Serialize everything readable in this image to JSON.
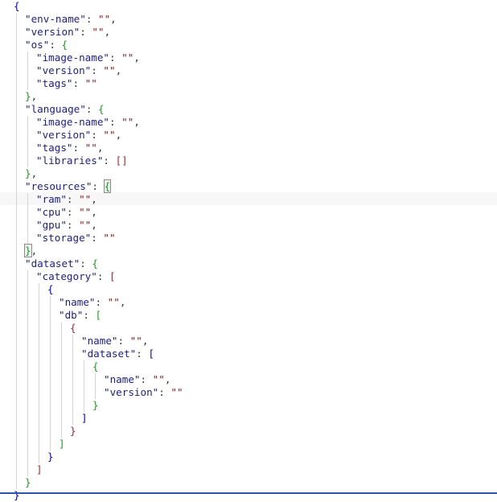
{
  "colors": {
    "key": "#1a1aa6",
    "string": "#a31515",
    "punct": "#333333",
    "bracket_levels": [
      "#0000c8",
      "#16a516",
      "#9b2c2c"
    ]
  },
  "editor": {
    "lines": [
      {
        "indent": 0,
        "tokens": [
          {
            "t": "{",
            "k": "b",
            "lv": 0
          }
        ]
      },
      {
        "indent": 1,
        "tokens": [
          {
            "t": "\"env-name\"",
            "k": "key"
          },
          {
            "t": ": ",
            "k": "p"
          },
          {
            "t": "\"\"",
            "k": "str"
          },
          {
            "t": ",",
            "k": "p"
          }
        ]
      },
      {
        "indent": 1,
        "tokens": [
          {
            "t": "\"version\"",
            "k": "key"
          },
          {
            "t": ": ",
            "k": "p"
          },
          {
            "t": "\"\"",
            "k": "str"
          },
          {
            "t": ",",
            "k": "p"
          }
        ]
      },
      {
        "indent": 1,
        "tokens": [
          {
            "t": "\"os\"",
            "k": "key"
          },
          {
            "t": ": ",
            "k": "p"
          },
          {
            "t": "{",
            "k": "b",
            "lv": 1
          }
        ]
      },
      {
        "indent": 2,
        "tokens": [
          {
            "t": "\"image-name\"",
            "k": "key"
          },
          {
            "t": ": ",
            "k": "p"
          },
          {
            "t": "\"\"",
            "k": "str"
          },
          {
            "t": ",",
            "k": "p"
          }
        ]
      },
      {
        "indent": 2,
        "tokens": [
          {
            "t": "\"version\"",
            "k": "key"
          },
          {
            "t": ": ",
            "k": "p"
          },
          {
            "t": "\"\"",
            "k": "str"
          },
          {
            "t": ",",
            "k": "p"
          }
        ]
      },
      {
        "indent": 2,
        "tokens": [
          {
            "t": "\"tags\"",
            "k": "key"
          },
          {
            "t": ": ",
            "k": "p"
          },
          {
            "t": "\"\"",
            "k": "str"
          }
        ]
      },
      {
        "indent": 1,
        "tokens": [
          {
            "t": "}",
            "k": "b",
            "lv": 1
          },
          {
            "t": ",",
            "k": "p"
          }
        ]
      },
      {
        "indent": 1,
        "tokens": [
          {
            "t": "\"language\"",
            "k": "key"
          },
          {
            "t": ": ",
            "k": "p"
          },
          {
            "t": "{",
            "k": "b",
            "lv": 1
          }
        ]
      },
      {
        "indent": 2,
        "tokens": [
          {
            "t": "\"image-name\"",
            "k": "key"
          },
          {
            "t": ": ",
            "k": "p"
          },
          {
            "t": "\"\"",
            "k": "str"
          },
          {
            "t": ",",
            "k": "p"
          }
        ]
      },
      {
        "indent": 2,
        "tokens": [
          {
            "t": "\"version\"",
            "k": "key"
          },
          {
            "t": ": ",
            "k": "p"
          },
          {
            "t": "\"\"",
            "k": "str"
          },
          {
            "t": ",",
            "k": "p"
          }
        ]
      },
      {
        "indent": 2,
        "tokens": [
          {
            "t": "\"tags\"",
            "k": "key"
          },
          {
            "t": ": ",
            "k": "p"
          },
          {
            "t": "\"\"",
            "k": "str"
          },
          {
            "t": ",",
            "k": "p"
          }
        ]
      },
      {
        "indent": 2,
        "tokens": [
          {
            "t": "\"libraries\"",
            "k": "key"
          },
          {
            "t": ": ",
            "k": "p"
          },
          {
            "t": "[]",
            "k": "b",
            "lv": 2
          }
        ]
      },
      {
        "indent": 1,
        "tokens": [
          {
            "t": "}",
            "k": "b",
            "lv": 1
          },
          {
            "t": ",",
            "k": "p"
          }
        ]
      },
      {
        "indent": 1,
        "tokens": [
          {
            "t": "\"resources\"",
            "k": "key"
          },
          {
            "t": ": ",
            "k": "p"
          },
          {
            "t": "{",
            "k": "b",
            "lv": 1,
            "hl": true
          }
        ]
      },
      {
        "indent": 2,
        "tokens": [
          {
            "t": "\"ram\"",
            "k": "key"
          },
          {
            "t": ": ",
            "k": "p"
          },
          {
            "t": "\"\"",
            "k": "str"
          },
          {
            "t": ",",
            "k": "p"
          }
        ]
      },
      {
        "indent": 2,
        "tokens": [
          {
            "t": "\"cpu\"",
            "k": "key"
          },
          {
            "t": ": ",
            "k": "p"
          },
          {
            "t": "\"\"",
            "k": "str"
          },
          {
            "t": ",",
            "k": "p"
          }
        ]
      },
      {
        "indent": 2,
        "tokens": [
          {
            "t": "\"gpu\"",
            "k": "key"
          },
          {
            "t": ": ",
            "k": "p"
          },
          {
            "t": "\"\"",
            "k": "str"
          },
          {
            "t": ",",
            "k": "p"
          }
        ]
      },
      {
        "indent": 2,
        "tokens": [
          {
            "t": "\"storage\"",
            "k": "key"
          },
          {
            "t": ": ",
            "k": "p"
          },
          {
            "t": "\"\"",
            "k": "str"
          }
        ]
      },
      {
        "indent": 1,
        "tokens": [
          {
            "t": "}",
            "k": "b",
            "lv": 1,
            "hl": true
          },
          {
            "t": ",",
            "k": "p"
          }
        ]
      },
      {
        "indent": 1,
        "tokens": [
          {
            "t": "\"dataset\"",
            "k": "key"
          },
          {
            "t": ": ",
            "k": "p"
          },
          {
            "t": "{",
            "k": "b",
            "lv": 1
          }
        ]
      },
      {
        "indent": 2,
        "tokens": [
          {
            "t": "\"category\"",
            "k": "key"
          },
          {
            "t": ": ",
            "k": "p"
          },
          {
            "t": "[",
            "k": "b",
            "lv": 2
          }
        ]
      },
      {
        "indent": 3,
        "tokens": [
          {
            "t": "{",
            "k": "b",
            "lv": 0
          }
        ]
      },
      {
        "indent": 4,
        "tokens": [
          {
            "t": "\"name\"",
            "k": "key"
          },
          {
            "t": ": ",
            "k": "p"
          },
          {
            "t": "\"\"",
            "k": "str"
          },
          {
            "t": ",",
            "k": "p"
          }
        ]
      },
      {
        "indent": 4,
        "tokens": [
          {
            "t": "\"db\"",
            "k": "key"
          },
          {
            "t": ": ",
            "k": "p"
          },
          {
            "t": "[",
            "k": "b",
            "lv": 1
          }
        ]
      },
      {
        "indent": 5,
        "tokens": [
          {
            "t": "{",
            "k": "b",
            "lv": 2
          }
        ]
      },
      {
        "indent": 6,
        "tokens": [
          {
            "t": "\"name\"",
            "k": "key"
          },
          {
            "t": ": ",
            "k": "p"
          },
          {
            "t": "\"\"",
            "k": "str"
          },
          {
            "t": ",",
            "k": "p"
          }
        ]
      },
      {
        "indent": 6,
        "tokens": [
          {
            "t": "\"dataset\"",
            "k": "key"
          },
          {
            "t": ": ",
            "k": "p"
          },
          {
            "t": "[",
            "k": "b",
            "lv": 0
          }
        ]
      },
      {
        "indent": 7,
        "tokens": [
          {
            "t": "{",
            "k": "b",
            "lv": 1
          }
        ]
      },
      {
        "indent": 8,
        "tokens": [
          {
            "t": "\"name\"",
            "k": "key"
          },
          {
            "t": ": ",
            "k": "p"
          },
          {
            "t": "\"\"",
            "k": "str"
          },
          {
            "t": ",",
            "k": "p"
          }
        ]
      },
      {
        "indent": 8,
        "tokens": [
          {
            "t": "\"version\"",
            "k": "key"
          },
          {
            "t": ": ",
            "k": "p"
          },
          {
            "t": "\"\"",
            "k": "str"
          }
        ]
      },
      {
        "indent": 7,
        "tokens": [
          {
            "t": "}",
            "k": "b",
            "lv": 1
          }
        ]
      },
      {
        "indent": 6,
        "tokens": [
          {
            "t": "]",
            "k": "b",
            "lv": 0
          }
        ]
      },
      {
        "indent": 5,
        "tokens": [
          {
            "t": "}",
            "k": "b",
            "lv": 2
          }
        ]
      },
      {
        "indent": 4,
        "tokens": [
          {
            "t": "]",
            "k": "b",
            "lv": 1
          }
        ]
      },
      {
        "indent": 3,
        "tokens": [
          {
            "t": "}",
            "k": "b",
            "lv": 0
          }
        ]
      },
      {
        "indent": 2,
        "tokens": [
          {
            "t": "]",
            "k": "b",
            "lv": 2
          }
        ]
      },
      {
        "indent": 1,
        "tokens": [
          {
            "t": "}",
            "k": "b",
            "lv": 1
          }
        ]
      },
      {
        "indent": 0,
        "tokens": [
          {
            "t": "}",
            "k": "b",
            "lv": 0
          }
        ]
      }
    ]
  }
}
